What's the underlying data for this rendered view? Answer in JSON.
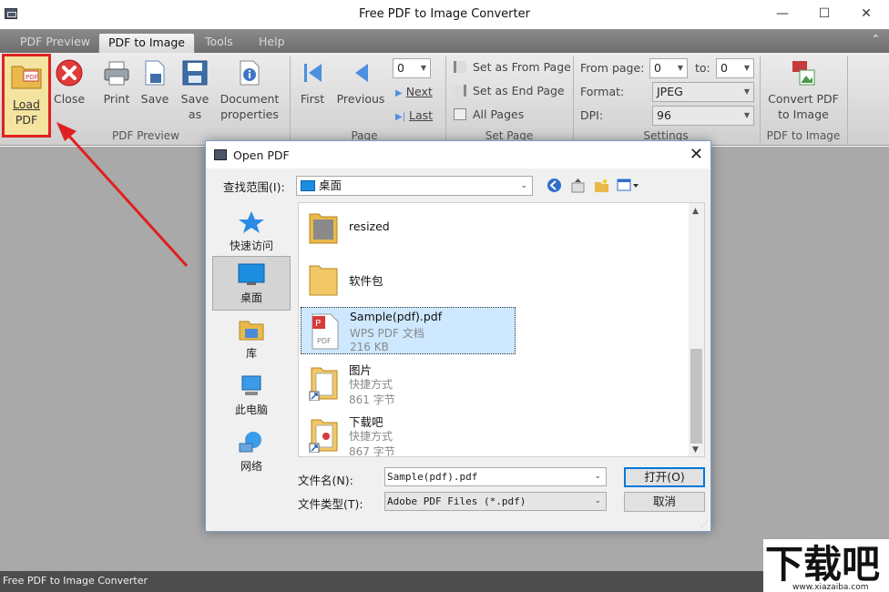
{
  "window": {
    "title": "Free PDF to Image Converter",
    "minimize": "—",
    "maximize": "☐",
    "close": "✕"
  },
  "ribbon": {
    "tabs": [
      {
        "label": "PDF Preview",
        "active": false
      },
      {
        "label": "PDF to Image",
        "active": true
      },
      {
        "label": "Tools",
        "active": false
      },
      {
        "label": "Help",
        "active": false
      }
    ],
    "groups": {
      "pdf_preview": {
        "label": "PDF Preview",
        "load": [
          "Load",
          "PDF"
        ],
        "close": "Close",
        "print": "Print",
        "save": "Save",
        "save_as": [
          "Save",
          "as"
        ],
        "doc_props": [
          "Document",
          "properties"
        ]
      },
      "page": {
        "label": "Page",
        "first": "First",
        "previous": "Previous",
        "page_number": "0",
        "next": "Next",
        "last": "Last"
      },
      "set_page": {
        "label": "Set Page",
        "from": "Set as From Page",
        "end": "Set as End Page",
        "all": "All Pages"
      },
      "settings": {
        "label": "Settings",
        "from_page_label": "From page:",
        "from_page": "0",
        "to_label": "to:",
        "to_page": "0",
        "format_label": "Format:",
        "format": "JPEG",
        "dpi_label": "DPI:",
        "dpi": "96"
      },
      "convert": {
        "label": "PDF to Image",
        "button": [
          "Convert PDF",
          "to Image"
        ]
      }
    }
  },
  "status": {
    "text": "Free PDF to Image Converter"
  },
  "dialog": {
    "title": "Open PDF",
    "lookin_label": "查找范围(I):",
    "lookin_value": "桌面",
    "places": [
      {
        "label": "快速访问",
        "icon": "star-icon"
      },
      {
        "label": "桌面",
        "icon": "desktop-icon",
        "active": true
      },
      {
        "label": "库",
        "icon": "library-icon"
      },
      {
        "label": "此电脑",
        "icon": "computer-icon"
      },
      {
        "label": "网络",
        "icon": "network-icon"
      }
    ],
    "files": [
      {
        "name": "resized",
        "type": "",
        "size": "",
        "icon": "folder-icon"
      },
      {
        "name": "软件包",
        "type": "",
        "size": "",
        "icon": "folder-icon"
      },
      {
        "name": "Sample(pdf).pdf",
        "type": "WPS PDF 文档",
        "size": "216 KB",
        "icon": "pdf-file-icon",
        "selected": true
      },
      {
        "name": "图片",
        "type": "快捷方式",
        "size": "861 字节",
        "icon": "shortcut-icon"
      },
      {
        "name": "下载吧",
        "type": "快捷方式",
        "size": "867 字节",
        "icon": "shortcut-icon"
      }
    ],
    "filename_label": "文件名(N):",
    "filename_value": "Sample(pdf).pdf",
    "filetype_label": "文件类型(T):",
    "filetype_value": "Adobe PDF Files (*.pdf)",
    "open_button": "打开(O)",
    "cancel_button": "取消"
  },
  "watermark": {
    "text": "下载吧",
    "url": "www.xiazaiba.com"
  },
  "colors": {
    "highlight_red": "#e02020",
    "selection_blue": "#cde8ff",
    "desktop_blue": "#1c8ee0"
  }
}
